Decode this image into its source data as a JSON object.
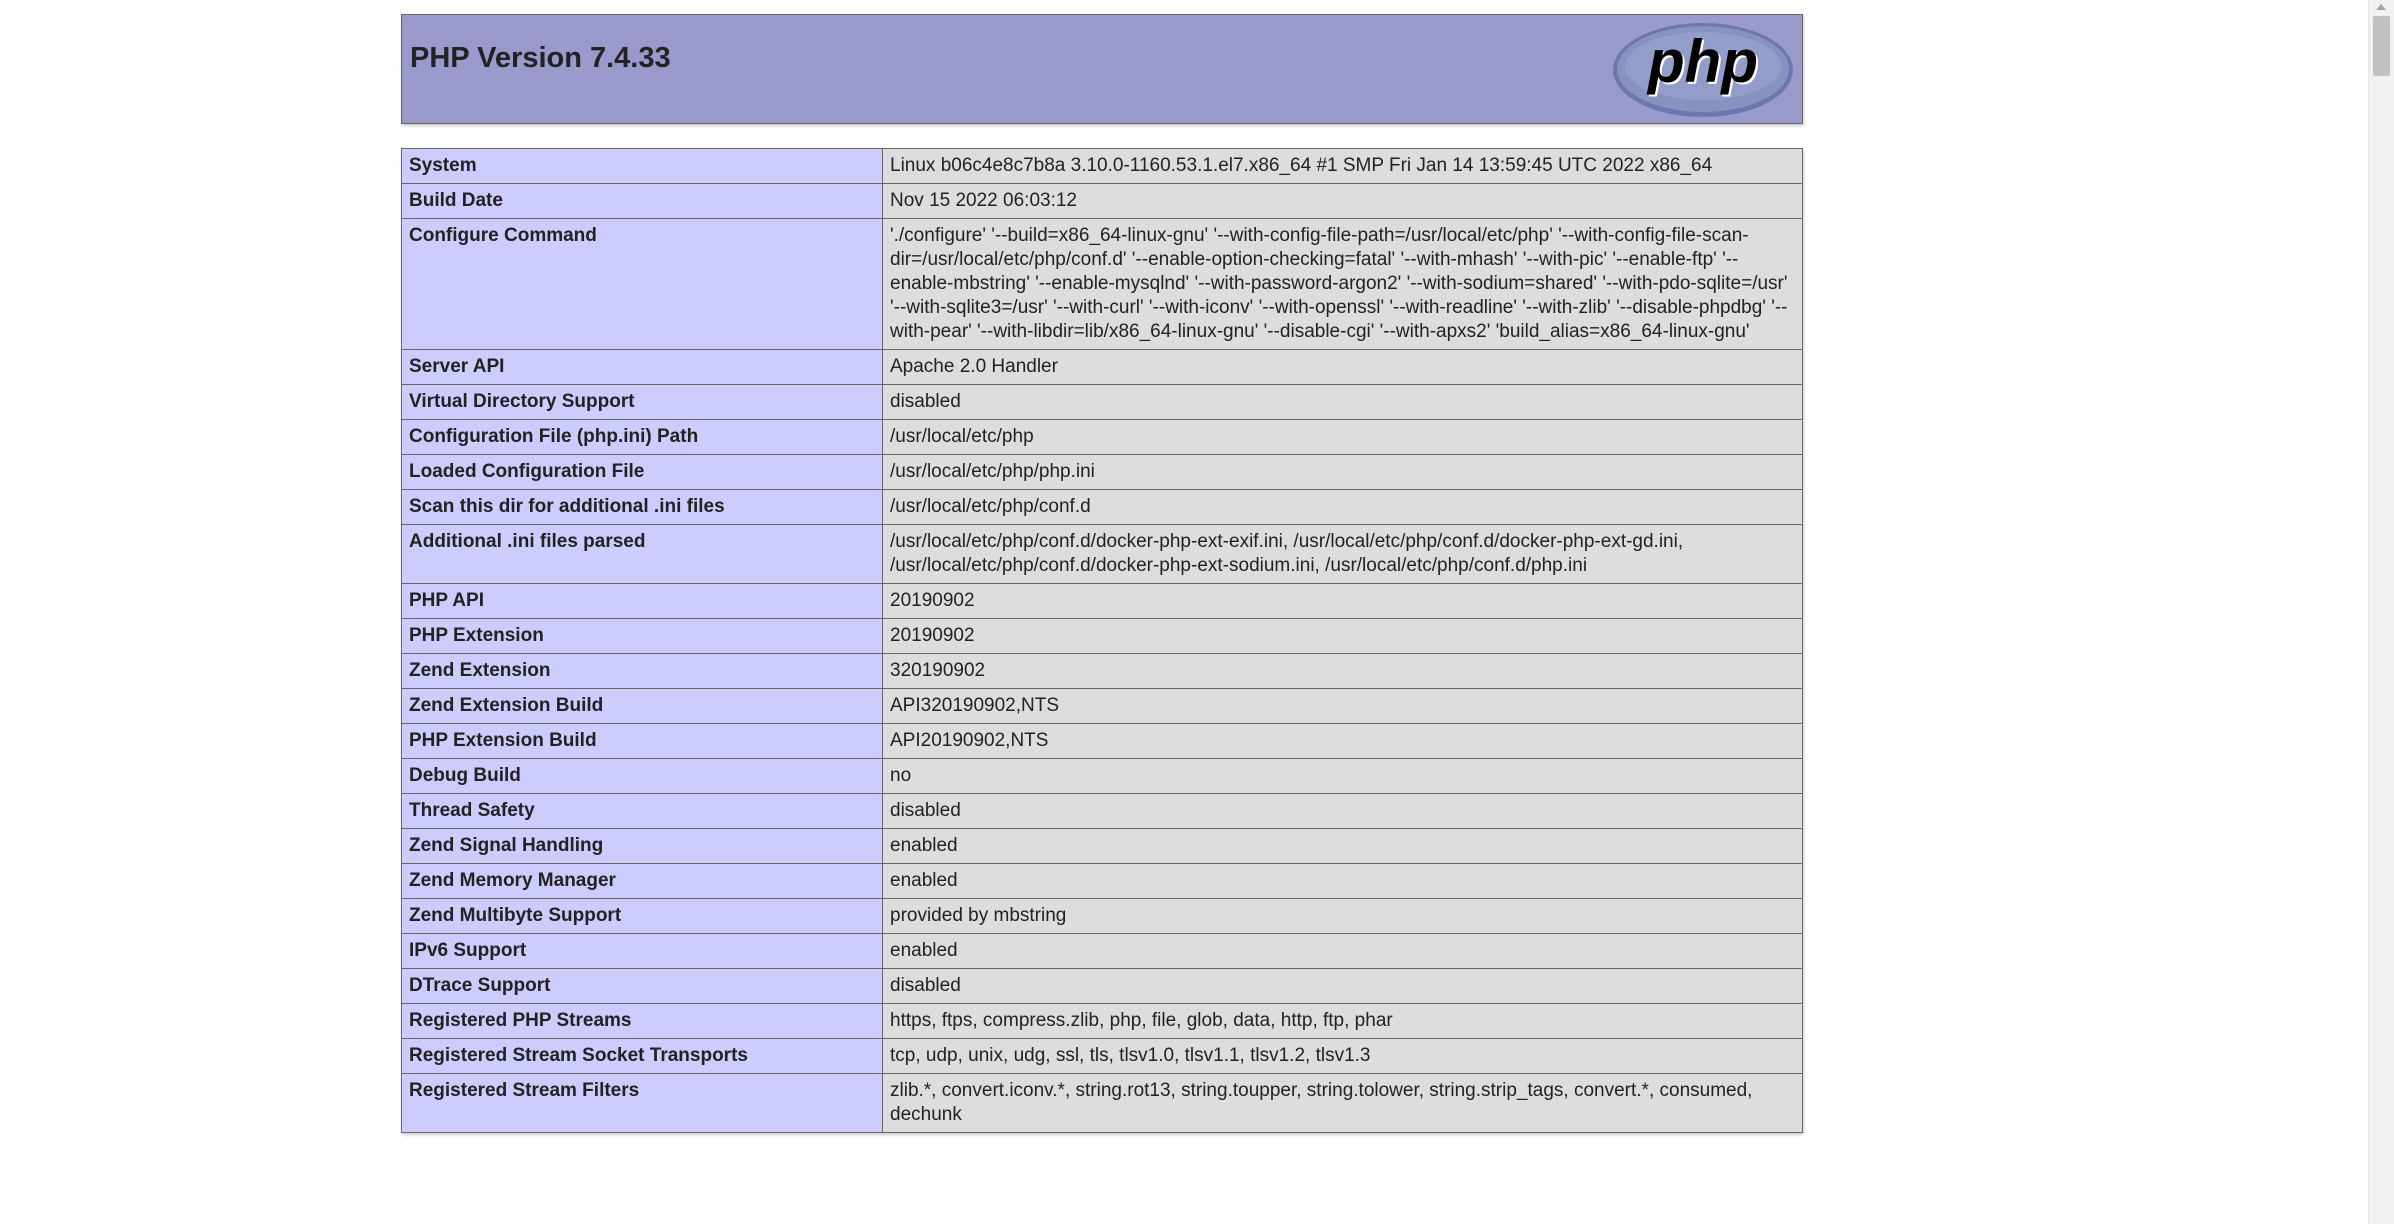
{
  "header": {
    "title": "PHP Version 7.4.33",
    "logo_text": "php",
    "logo_color": "#8892bf",
    "background": "#9999cc"
  },
  "rows": [
    {
      "key": "System",
      "value": "Linux b06c4e8c7b8a 3.10.0-1160.53.1.el7.x86_64 #1 SMP Fri Jan 14 13:59:45 UTC 2022 x86_64"
    },
    {
      "key": "Build Date",
      "value": "Nov 15 2022 06:03:12"
    },
    {
      "key": "Configure Command",
      "value": "'./configure' '--build=x86_64-linux-gnu' '--with-config-file-path=/usr/local/etc/php' '--with-config-file-scan-dir=/usr/local/etc/php/conf.d' '--enable-option-checking=fatal' '--with-mhash' '--with-pic' '--enable-ftp' '--enable-mbstring' '--enable-mysqlnd' '--with-password-argon2' '--with-sodium=shared' '--with-pdo-sqlite=/usr' '--with-sqlite3=/usr' '--with-curl' '--with-iconv' '--with-openssl' '--with-readline' '--with-zlib' '--disable-phpdbg' '--with-pear' '--with-libdir=lib/x86_64-linux-gnu' '--disable-cgi' '--with-apxs2' 'build_alias=x86_64-linux-gnu'"
    },
    {
      "key": "Server API",
      "value": "Apache 2.0 Handler"
    },
    {
      "key": "Virtual Directory Support",
      "value": "disabled"
    },
    {
      "key": "Configuration File (php.ini) Path",
      "value": "/usr/local/etc/php"
    },
    {
      "key": "Loaded Configuration File",
      "value": "/usr/local/etc/php/php.ini"
    },
    {
      "key": "Scan this dir for additional .ini files",
      "value": "/usr/local/etc/php/conf.d"
    },
    {
      "key": "Additional .ini files parsed",
      "value": "/usr/local/etc/php/conf.d/docker-php-ext-exif.ini, /usr/local/etc/php/conf.d/docker-php-ext-gd.ini, /usr/local/etc/php/conf.d/docker-php-ext-sodium.ini, /usr/local/etc/php/conf.d/php.ini"
    },
    {
      "key": "PHP API",
      "value": "20190902"
    },
    {
      "key": "PHP Extension",
      "value": "20190902"
    },
    {
      "key": "Zend Extension",
      "value": "320190902"
    },
    {
      "key": "Zend Extension Build",
      "value": "API320190902,NTS"
    },
    {
      "key": "PHP Extension Build",
      "value": "API20190902,NTS"
    },
    {
      "key": "Debug Build",
      "value": "no"
    },
    {
      "key": "Thread Safety",
      "value": "disabled"
    },
    {
      "key": "Zend Signal Handling",
      "value": "enabled"
    },
    {
      "key": "Zend Memory Manager",
      "value": "enabled"
    },
    {
      "key": "Zend Multibyte Support",
      "value": "provided by mbstring"
    },
    {
      "key": "IPv6 Support",
      "value": "enabled"
    },
    {
      "key": "DTrace Support",
      "value": "disabled"
    },
    {
      "key": "Registered PHP Streams",
      "value": "https, ftps, compress.zlib, php, file, glob, data, http, ftp, phar"
    },
    {
      "key": "Registered Stream Socket Transports",
      "value": "tcp, udp, unix, udg, ssl, tls, tlsv1.0, tlsv1.1, tlsv1.2, tlsv1.3"
    },
    {
      "key": "Registered Stream Filters",
      "value": "zlib.*, convert.iconv.*, string.rot13, string.toupper, string.tolower, string.strip_tags, convert.*, consumed, dechunk"
    }
  ]
}
